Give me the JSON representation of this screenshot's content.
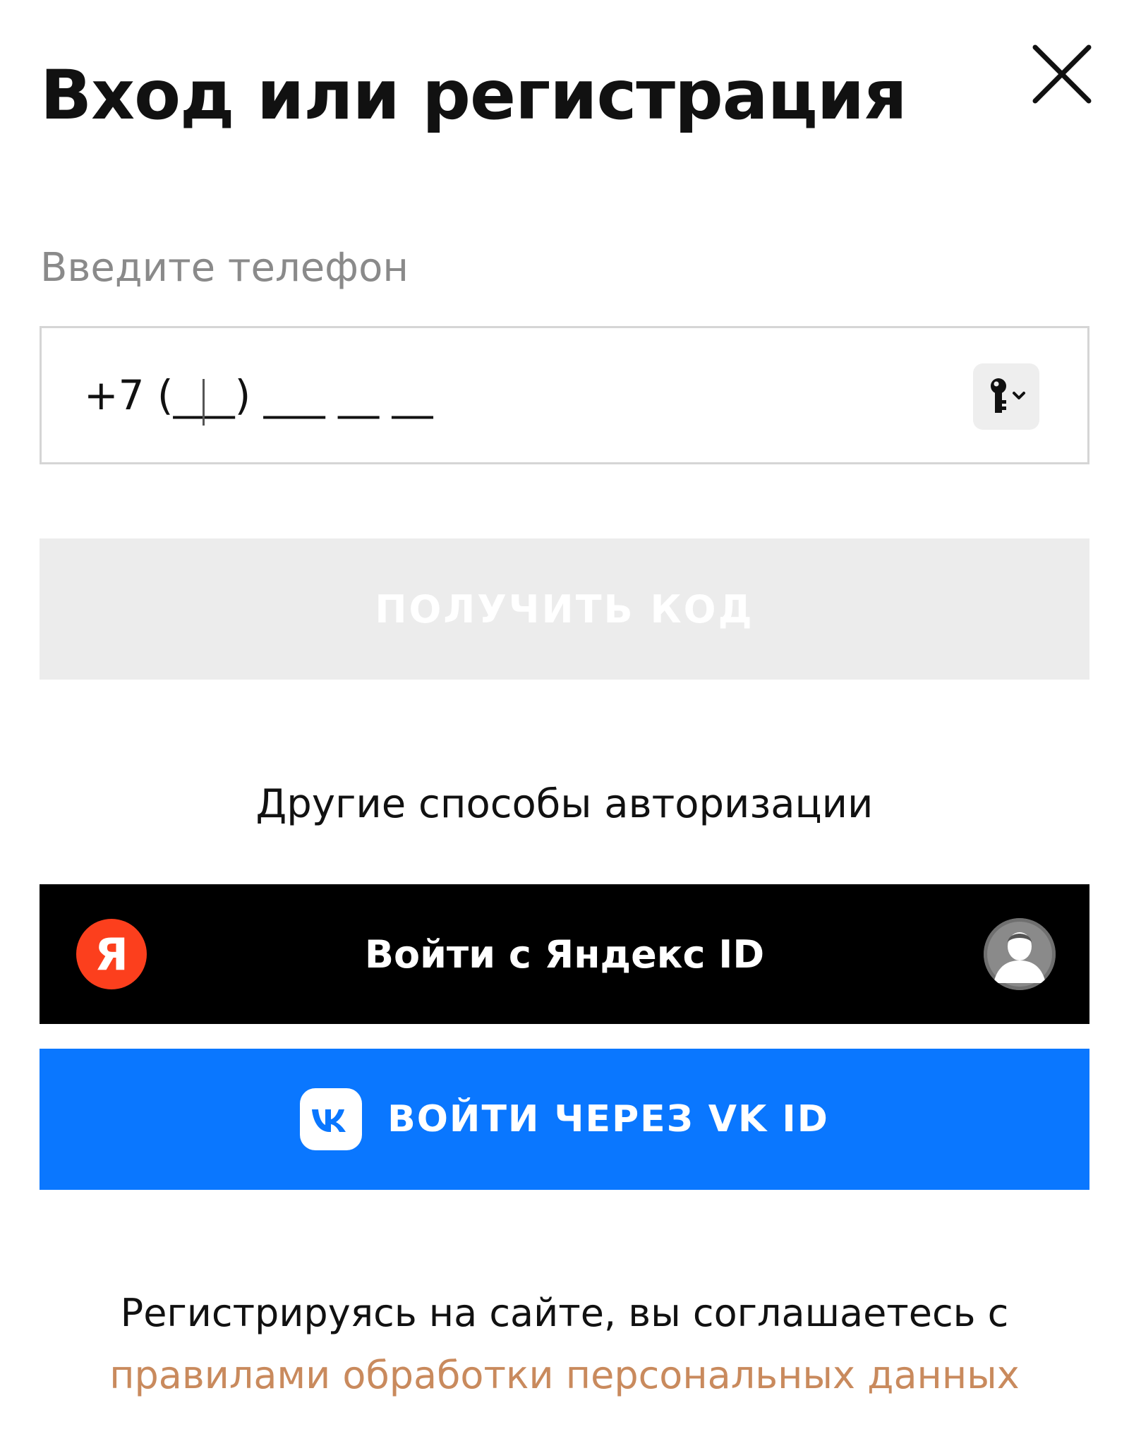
{
  "modal": {
    "title": "Вход или регистрация"
  },
  "phone": {
    "label": "Введите телефон",
    "placeholder": "+7 (___) ___ __ __",
    "value": ""
  },
  "get_code": {
    "label": "Получить код"
  },
  "other_methods": {
    "heading": "Другие способы авторизации"
  },
  "yandex": {
    "logo_letter": "Я",
    "label": "Войти с Яндекс ID"
  },
  "vk": {
    "label": "Войти через VK ID"
  },
  "consent": {
    "text": "Регистрируясь на сайте, вы соглашаетесь с",
    "link": "правилами обработки персональных данных"
  },
  "colors": {
    "text_primary": "#111111",
    "label_gray": "#8a8a8a",
    "button_disabled_bg": "#ececec",
    "yandex_bg": "#000000",
    "yandex_red": "#fc3f1d",
    "vk_blue": "#0a77ff",
    "link_color": "#c98a5d"
  },
  "icons": {
    "close": "close-icon",
    "keychain": "key-icon",
    "yandex_logo": "yandex-logo-icon",
    "yandex_avatar": "user-avatar-icon",
    "vk_logo": "vk-logo-icon"
  }
}
